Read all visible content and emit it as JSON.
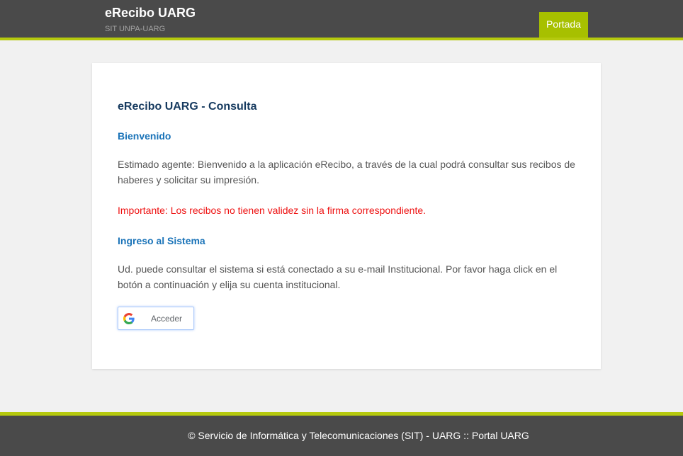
{
  "header": {
    "title": "eRecibo UARG",
    "subtitle": "SIT UNPA-UARG",
    "nav_portada": "Portada"
  },
  "main": {
    "page_title": "eRecibo UARG - Consulta",
    "welcome_heading": "Bienvenido",
    "welcome_text": "Estimado agente: Bienvenido a la aplicación eRecibo, a través de la cual podrá consultar sus recibos de haberes y solicitar su impresión.",
    "warning_text": "Importante: Los recibos no tienen validez sin la firma correspondiente.",
    "login_heading": "Ingreso al Sistema",
    "login_text": "Ud. puede consultar el sistema si está conectado a su e-mail Institucional. Por favor haga click en el botón a continuación y elija su cuenta institucional.",
    "google_button_label": "Acceder"
  },
  "footer": {
    "text": "© Servicio de Informática y Telecomunicaciones (SIT) - UARG :: Portal UARG"
  },
  "colors": {
    "header_bg": "#4a4a4a",
    "accent": "#b5c90e",
    "nav_active": "#a7c000",
    "title_color": "#163a5f",
    "section_color": "#1a73b8",
    "warning_color": "#ee1111"
  },
  "icons": {
    "google": "google-g-icon"
  }
}
